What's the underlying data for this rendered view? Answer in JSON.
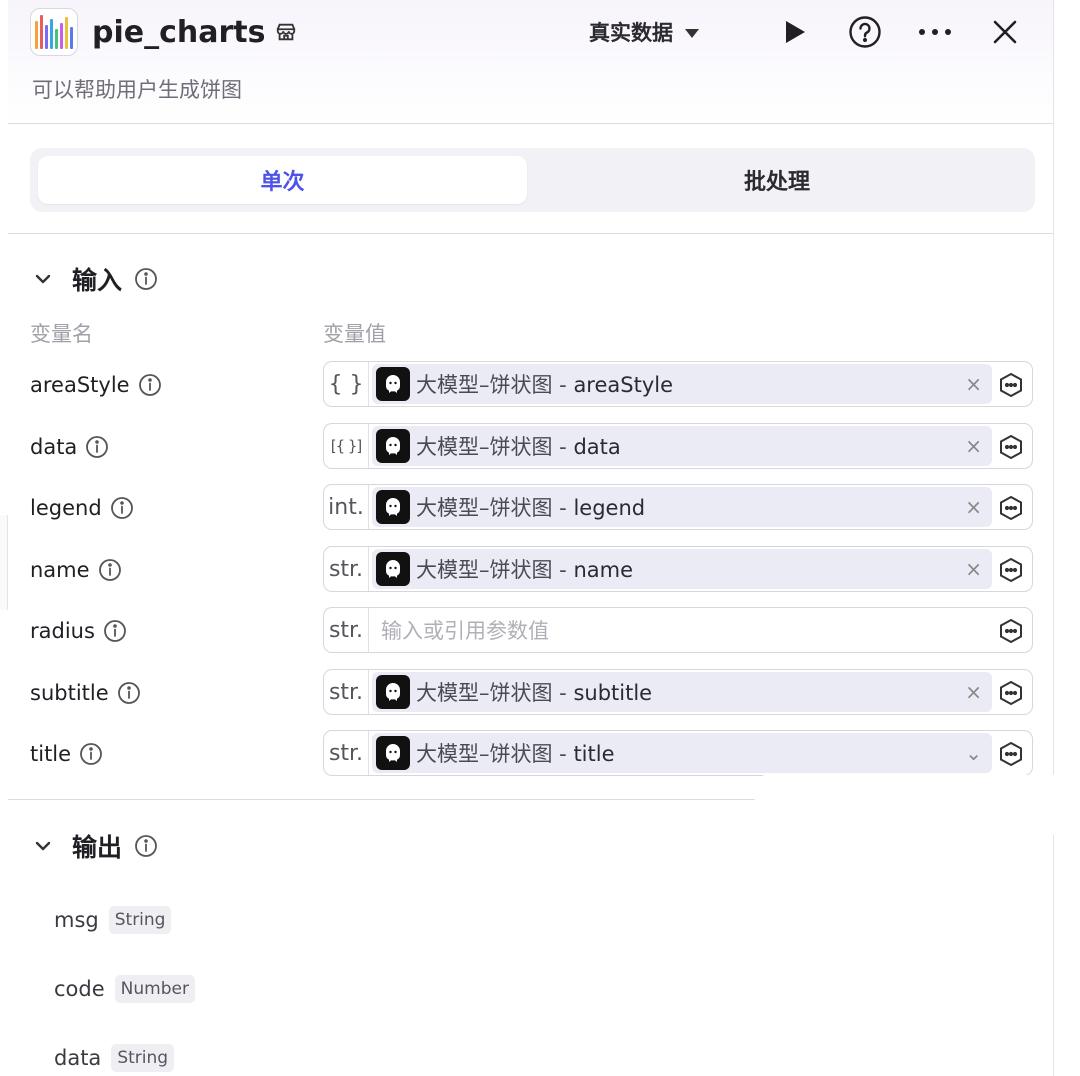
{
  "header": {
    "title": "pie_charts",
    "description": "可以帮助用户生成饼图",
    "mode_label": "真实数据"
  },
  "tabs": [
    {
      "label": "单次",
      "active": true
    },
    {
      "label": "批处理",
      "active": false
    }
  ],
  "input_section": {
    "title": "输入",
    "col_name": "变量名",
    "col_value": "变量值",
    "placeholder": "输入或引用参数值",
    "rows": [
      {
        "name": "areaStyle",
        "type": "{ }",
        "ref_prefix": "大模型–饼状图 - ",
        "ref_var": "areaStyle",
        "clear": "×"
      },
      {
        "name": "data",
        "type": "[{ }]",
        "ref_prefix": "大模型–饼状图 - ",
        "ref_var": "data",
        "clear": "×"
      },
      {
        "name": "legend",
        "type": "int.",
        "ref_prefix": "大模型–饼状图 - ",
        "ref_var": "legend",
        "clear": "×"
      },
      {
        "name": "name",
        "type": "str.",
        "ref_prefix": "大模型–饼状图 - ",
        "ref_var": "name",
        "clear": "×"
      },
      {
        "name": "radius",
        "type": "str.",
        "ref_prefix": "",
        "ref_var": "",
        "clear": ""
      },
      {
        "name": "subtitle",
        "type": "str.",
        "ref_prefix": "大模型–饼状图 - ",
        "ref_var": "subtitle",
        "clear": "×"
      },
      {
        "name": "title",
        "type": "str.",
        "ref_prefix": "大模型–饼状图 - ",
        "ref_var": "title",
        "clear": "⌄"
      }
    ]
  },
  "output_section": {
    "title": "输出",
    "fields": [
      {
        "name": "msg",
        "type": "String"
      },
      {
        "name": "code",
        "type": "Number"
      },
      {
        "name": "data",
        "type": "String"
      }
    ]
  },
  "colors": {
    "accent": "#4d53e8",
    "chip_bg": "#ebebf5",
    "border": "#d6d6dc"
  },
  "icons": {
    "logo": "bar-chart-logo-icon",
    "store": "store-icon",
    "run": "play-icon",
    "help": "help-circle-icon",
    "more": "more-icon",
    "close": "close-icon",
    "expand": "chevron-down-icon",
    "info": "info-icon",
    "ref_avatar": "bot-avatar-icon",
    "variable": "variable-hex-icon"
  }
}
